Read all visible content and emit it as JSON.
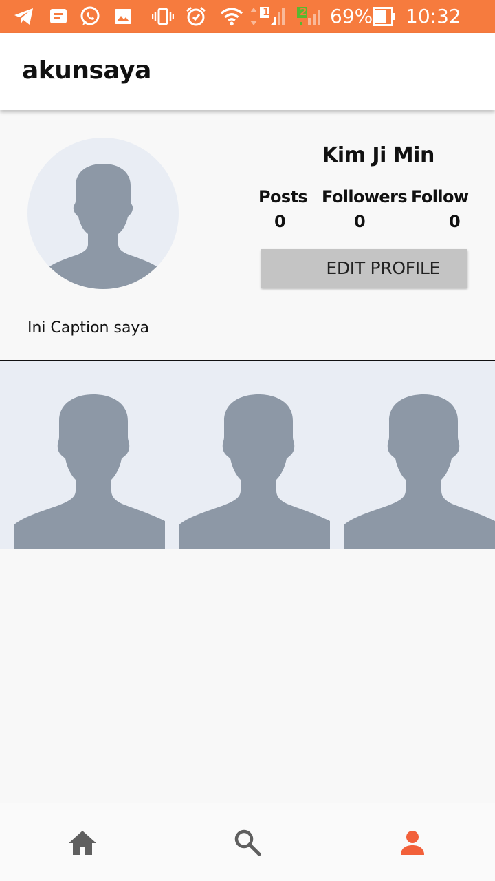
{
  "status_bar": {
    "battery": "69%",
    "time": "10:32 AM",
    "signal_badge_1": "1",
    "signal_badge_2": "2",
    "icons": [
      "telegram-icon",
      "message-icon",
      "whatsapp-icon",
      "gallery-icon",
      "vibrate-icon",
      "alarm-icon",
      "wifi-icon",
      "signal-icon",
      "signal-icon",
      "battery-icon"
    ]
  },
  "app_bar": {
    "title": "akunsaya"
  },
  "profile": {
    "name": "Kim Ji Min",
    "caption": "Ini Caption saya",
    "stats": [
      {
        "label": "Posts",
        "value": "0"
      },
      {
        "label": "Followers",
        "value": "0"
      },
      {
        "label": "Following",
        "value": "0"
      }
    ],
    "edit_button": "EDIT PROFILE"
  },
  "posts": {
    "count": 3
  },
  "bottom_nav": {
    "items": [
      {
        "icon": "home-icon"
      },
      {
        "icon": "search-icon"
      },
      {
        "icon": "person-icon"
      }
    ],
    "active_index": 2
  },
  "colors": {
    "status_bar": "#f67b3e",
    "avatar_bg": "#e9edf4",
    "silhouette": "#8d98a6",
    "nav_inactive": "#5f5f5f",
    "nav_active": "#f2603a",
    "button_bg": "#c4c4c4"
  }
}
